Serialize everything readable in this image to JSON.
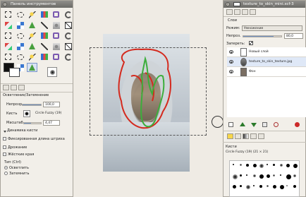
{
  "toolbox": {
    "title": "Панель инструментов",
    "tools": [
      {
        "name": "rect-select-icon"
      },
      {
        "name": "ellipse-select-icon"
      },
      {
        "name": "free-select-icon"
      },
      {
        "name": "fuzzy-select-icon"
      },
      {
        "name": "select-by-color-icon"
      },
      {
        "name": "scissors-icon"
      },
      {
        "name": "paths-icon"
      },
      {
        "name": "color-picker-icon"
      },
      {
        "name": "zoom-icon"
      },
      {
        "name": "measure-icon"
      },
      {
        "name": "move-icon"
      },
      {
        "name": "align-icon"
      },
      {
        "name": "crop-icon"
      },
      {
        "name": "rotate-icon"
      },
      {
        "name": "scale-icon"
      },
      {
        "name": "shear-icon"
      },
      {
        "name": "perspective-icon"
      },
      {
        "name": "flip-icon"
      },
      {
        "name": "cage-icon"
      },
      {
        "name": "text-icon"
      },
      {
        "name": "bucket-fill-icon"
      },
      {
        "name": "blend-icon"
      },
      {
        "name": "pencil-icon"
      },
      {
        "name": "paintbrush-icon"
      },
      {
        "name": "eraser-icon"
      },
      {
        "name": "airbrush-icon"
      },
      {
        "name": "ink-icon"
      },
      {
        "name": "clone-icon"
      },
      {
        "name": "heal-icon"
      },
      {
        "name": "perspective-clone-icon"
      },
      {
        "name": "blur-icon"
      },
      {
        "name": "smudge-icon"
      },
      {
        "name": "dodge-burn-icon"
      }
    ],
    "colors": {
      "fg": "#111111",
      "bg": "#ffffff"
    },
    "options": {
      "tool_name": "Осветление/Затемнение",
      "opacity_label": "Непрозр.",
      "opacity_value": "100,0",
      "opacity_fraction": 1.0,
      "brush_label": "Кисть",
      "brush_value": "Circle Fuzzy (19)",
      "scale_label": "Масштаб",
      "scale_value": "4,47",
      "dynamics_label": "Динамика кисти",
      "fixed_length_label": "Фиксированная длина штриха",
      "jitter_label": "Дрожание",
      "hard_edge_label": "Жёсткие края",
      "type_label": "Тип  (Ctrl)",
      "type_options": [
        "Осветлить",
        "Затемнить"
      ]
    }
  },
  "layers_panel": {
    "title": "texture_to_skin_mini.xcf-3",
    "tab_title": "Слои",
    "mode_label": "Режим:",
    "mode_value": "Умножение",
    "opacity_label": "Непроз.",
    "opacity_value": "80,0",
    "opacity_fraction": 0.8,
    "lock_label": "Запереть:",
    "layers": [
      {
        "name": "Новый слой",
        "selected": false
      },
      {
        "name": "texture_to_skin_texture.jpg",
        "selected": true
      },
      {
        "name": "Фон",
        "selected": false
      }
    ],
    "brushes_title": "Кисти",
    "brushes_current": "Circle Fuzzy (19) (21 × 21)"
  }
}
